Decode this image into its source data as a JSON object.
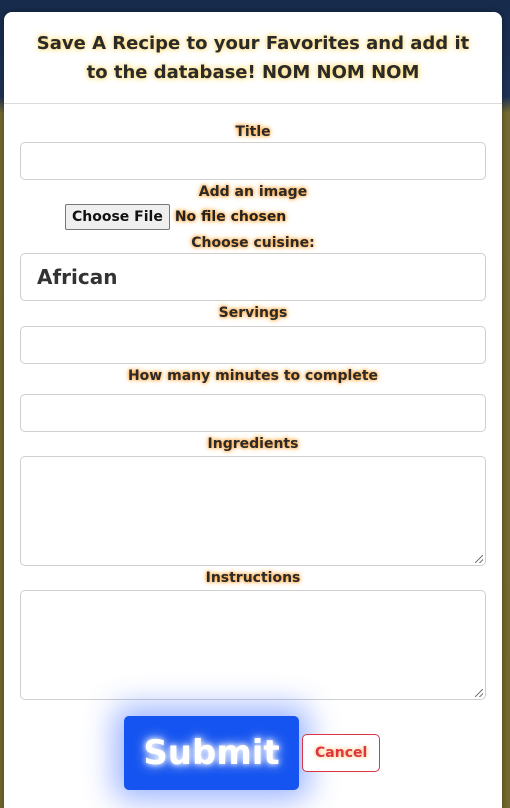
{
  "modal": {
    "title": "Save A Recipe to your Favorites and add it to the database! NOM NOM NOM"
  },
  "form": {
    "title_label": "Title",
    "title_value": "",
    "image_label": "Add an image",
    "file_button": "Choose File",
    "file_status": "No file chosen",
    "cuisine_label": "Choose cuisine:",
    "cuisine_selected": "African",
    "servings_label": "Servings",
    "servings_value": "",
    "minutes_label": "How many minutes to complete",
    "minutes_value": "",
    "ingredients_label": "Ingredients",
    "ingredients_value": "",
    "instructions_label": "Instructions",
    "instructions_value": ""
  },
  "actions": {
    "submit_label": "Submit",
    "cancel_label": "Cancel"
  },
  "colors": {
    "submit_bg": "#1554f0",
    "cancel_border": "#dc3545",
    "label_glow": "#ff9a2a"
  }
}
